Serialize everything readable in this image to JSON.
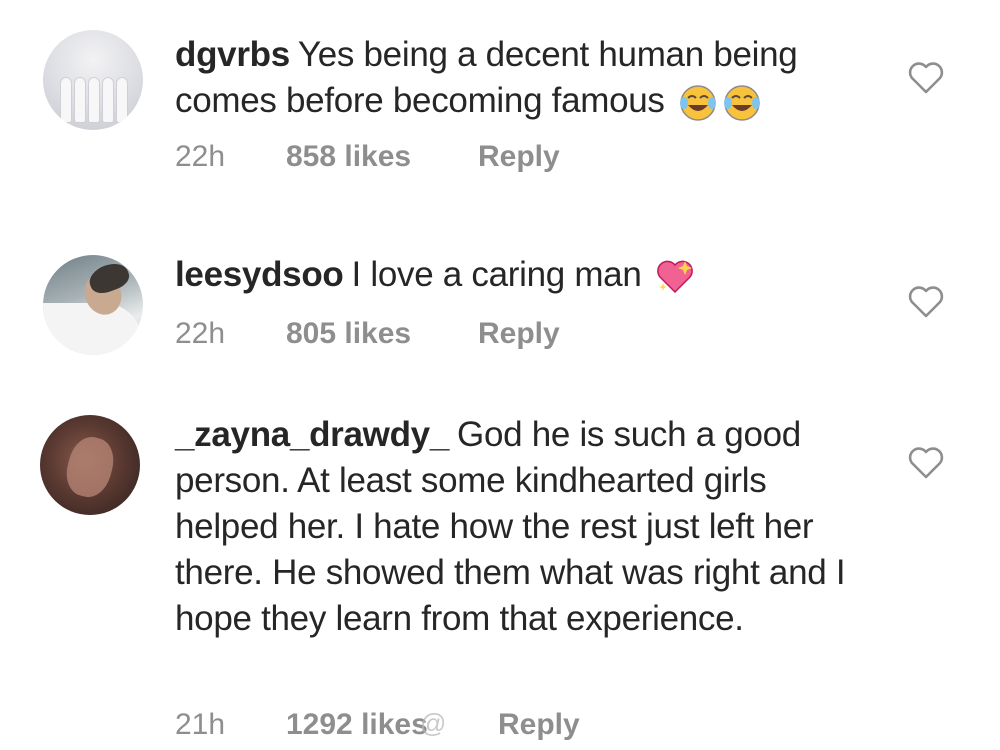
{
  "comments": [
    {
      "username": "dgvrbs",
      "text": "Yes being a decent human being comes before becoming famous",
      "emoji": [
        "tears-of-joy-emoji",
        "tears-of-joy-emoji"
      ],
      "time": "22h",
      "likes": "858 likes",
      "reply": "Reply"
    },
    {
      "username": "leesydsoo",
      "text": "I love a caring man",
      "emoji": [
        "sparkling-heart-emoji"
      ],
      "time": "22h",
      "likes": "805 likes",
      "reply": "Reply"
    },
    {
      "username": "_zayna_drawdy_",
      "text": "God he is such a good person. At least some kindhearted girls helped her. I hate how the rest just left her there. He showed them what was right and I hope they learn from that experience.",
      "time": "21h",
      "likes": "1292 likes",
      "reply": "Reply"
    }
  ],
  "watermark": "@",
  "colors": {
    "text": "#262626",
    "meta": "#8e8e8e",
    "emoji_face": "#f9c23c",
    "heart_emoji": "#f06292"
  }
}
